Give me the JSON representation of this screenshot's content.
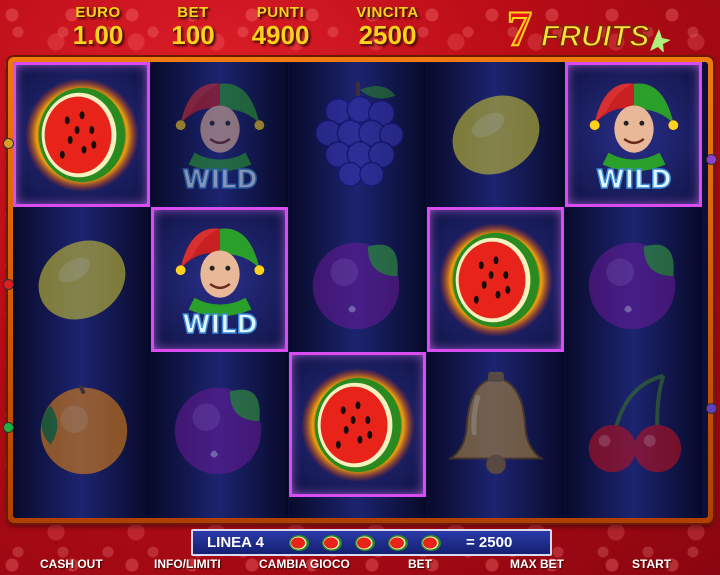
{
  "header": {
    "euro": {
      "label": "EURO",
      "value": "1.00"
    },
    "bet": {
      "label": "BET",
      "value": "100"
    },
    "punti": {
      "label": "PUNTI",
      "value": "4900"
    },
    "vincita": {
      "label": "VINCITA",
      "value": "2500"
    }
  },
  "logo": {
    "seven": "7",
    "text": "FRUITS"
  },
  "reels": [
    [
      {
        "symbol": "watermelon",
        "win": true
      },
      {
        "symbol": "lemon",
        "win": false
      },
      {
        "symbol": "orange",
        "win": false
      }
    ],
    [
      {
        "symbol": "wild-jester",
        "win": false,
        "label": "WILD"
      },
      {
        "symbol": "wild-jester",
        "win": true,
        "label": "WILD"
      },
      {
        "symbol": "plum",
        "win": false
      }
    ],
    [
      {
        "symbol": "grapes",
        "win": false
      },
      {
        "symbol": "plum",
        "win": false
      },
      {
        "symbol": "watermelon",
        "win": true
      }
    ],
    [
      {
        "symbol": "lemon",
        "win": false
      },
      {
        "symbol": "watermelon",
        "win": true
      },
      {
        "symbol": "bell",
        "win": false
      }
    ],
    [
      {
        "symbol": "wild-jester",
        "win": true,
        "label": "WILD"
      },
      {
        "symbol": "plum",
        "win": false
      },
      {
        "symbol": "cherries",
        "win": false
      }
    ]
  ],
  "winline": {
    "line_label": "LINEA 4",
    "symbol": "watermelon",
    "count": 5,
    "amount": "= 2500"
  },
  "buttons": {
    "cash_out": "CASH OUT",
    "info": "INFO/LIMITI",
    "change_game": "CAMBIA GIOCO",
    "bet": "BET",
    "max_bet": "MAX BET",
    "start": "START"
  },
  "colors": {
    "highlight": "#d84cf0",
    "gold": "#ffd21c",
    "reel_bg": "#0b0f3a"
  }
}
